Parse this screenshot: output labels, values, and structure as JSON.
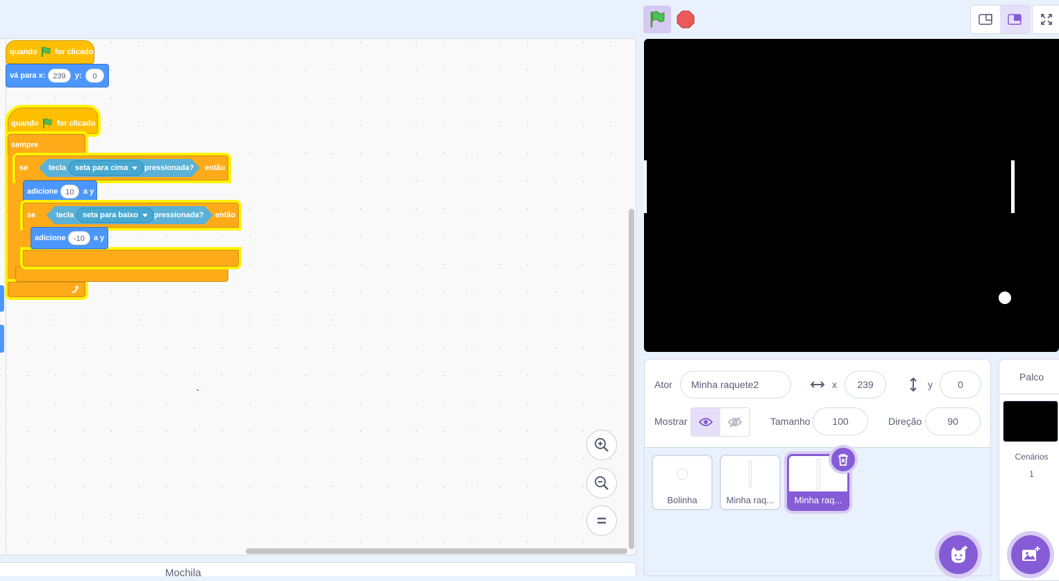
{
  "colors": {
    "accent": "#855cd6",
    "events": "#ffbf00",
    "control": "#ffab19",
    "motion": "#4c97ff",
    "sensing": "#5cb1d6",
    "glow": "#fff200",
    "flag_green": "#4cbf56",
    "stop_red": "#ec5959"
  },
  "scripts": {
    "script1": {
      "hat_when": "quando",
      "hat_clicked": "for clicado",
      "goto_label": "vá para x:",
      "goto_x": "239",
      "goto_y_label": "y:",
      "goto_y": "0"
    },
    "script2": {
      "hat_when": "quando",
      "hat_clicked": "for clicado",
      "forever": "sempre",
      "if1_label": "se",
      "if1_then": "então",
      "key1_label": "tecla",
      "key1_value": "seta para cima",
      "key1_pressed": "pressionada?",
      "change1_label": "adicione",
      "change1_value": "10",
      "change1_suffix": "a y",
      "if2_label": "se",
      "if2_then": "então",
      "key2_label": "tecla",
      "key2_value": "seta para baixo",
      "key2_pressed": "pressionada?",
      "change2_label": "adicione",
      "change2_value": "-10",
      "change2_suffix": "a y"
    }
  },
  "backpack": {
    "label": "Mochila"
  },
  "sprite_info": {
    "sprite_label": "Ator",
    "sprite_name": "Minha raquete2",
    "x_label": "x",
    "x_value": "239",
    "y_label": "y",
    "y_value": "0",
    "show_label": "Mostrar",
    "size_label": "Tamanho",
    "size_value": "100",
    "direction_label": "Direção",
    "direction_value": "90"
  },
  "sprites": [
    {
      "name": "Bolinha",
      "selected": false
    },
    {
      "name": "Minha raq...",
      "selected": false
    },
    {
      "name": "Minha raq...",
      "selected": true
    }
  ],
  "stage_panel": {
    "title": "Palco",
    "backdrops_label": "Cenários",
    "backdrops_count": "1"
  },
  "icons": {
    "green_flag": "green-flag-icon",
    "stop": "stop-icon",
    "small_stage": "small-stage-icon",
    "normal_stage": "normal-stage-icon",
    "fullscreen": "fullscreen-icon",
    "zoom_in": "zoom-in-icon",
    "zoom_out": "zoom-out-icon",
    "zoom_reset": "zoom-reset-icon",
    "eye": "eye-icon",
    "eye_off": "eye-off-icon",
    "trash": "trash-icon",
    "add_sprite": "cat-add-icon",
    "add_backdrop": "backdrop-add-icon"
  }
}
